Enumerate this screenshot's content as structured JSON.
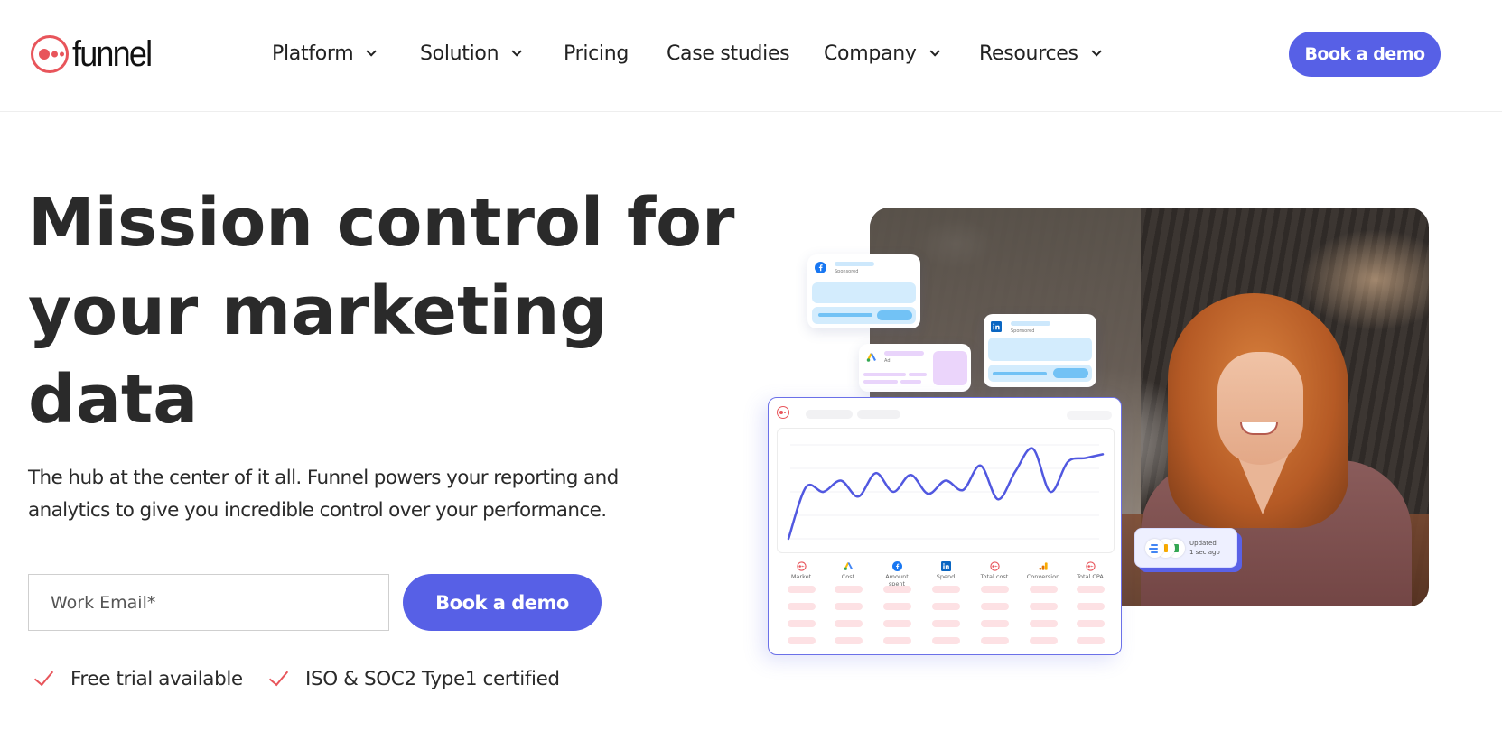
{
  "header": {
    "logo_text": "funnel",
    "nav": [
      {
        "label": "Platform",
        "has_dropdown": true
      },
      {
        "label": "Solution",
        "has_dropdown": true
      },
      {
        "label": "Pricing",
        "has_dropdown": false
      },
      {
        "label": "Case studies",
        "has_dropdown": false
      },
      {
        "label": "Company",
        "has_dropdown": true
      },
      {
        "label": "Resources",
        "has_dropdown": true
      }
    ],
    "cta_label": "Book a demo"
  },
  "hero": {
    "headline_lines": [
      "Mission control for",
      "your marketing",
      "data"
    ],
    "subtext": "The hub at the center of it all. Funnel powers your reporting and analytics to give you incredible control over your performance.",
    "email_placeholder": "Work Email*",
    "email_value": "",
    "cta_label": "Book a demo",
    "checks": [
      "Free trial available",
      "ISO & SOC2 Type1 certified"
    ]
  },
  "illustration": {
    "facebook_card": {
      "label": "Sponsored",
      "icon": "facebook-icon"
    },
    "google_ads_card": {
      "label": "Ad",
      "icon": "google-ads-icon"
    },
    "linkedin_card": {
      "label": "Sponsored",
      "icon": "linkedin-icon"
    },
    "dashboard": {
      "columns": [
        {
          "label": "Market",
          "icon": "funnel-icon"
        },
        {
          "label": "Cost",
          "icon": "google-ads-icon"
        },
        {
          "label": "Amount spent",
          "icon": "facebook-icon"
        },
        {
          "label": "Spend",
          "icon": "linkedin-icon"
        },
        {
          "label": "Total cost",
          "icon": "funnel-icon"
        },
        {
          "label": "Conversion",
          "icon": "analytics-icon"
        },
        {
          "label": "Total CPA",
          "icon": "funnel-icon"
        }
      ],
      "placeholder_rows": 4,
      "trend_values": [
        0,
        0.55,
        0.5,
        0.62,
        0.45,
        0.7,
        0.5,
        0.68,
        0.48,
        0.62,
        0.52,
        0.78,
        0.42,
        0.72,
        0.96,
        0.5,
        0.82,
        0.86,
        0.9
      ]
    },
    "updated_badge": {
      "line1": "Updated",
      "line2": "1 sec ago"
    }
  },
  "colors": {
    "accent": "#5760e6",
    "brand_red": "#e8555b",
    "text": "#2a2a2a"
  }
}
